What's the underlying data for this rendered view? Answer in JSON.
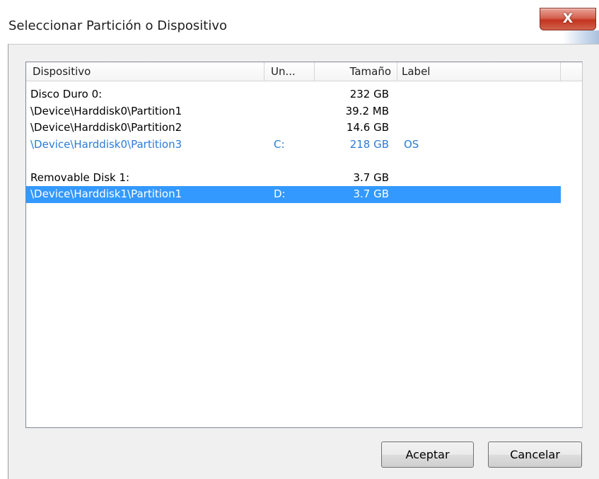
{
  "window": {
    "title": "Seleccionar Partición o Dispositivo",
    "close_label": "X"
  },
  "list": {
    "columns": [
      "Dispositivo",
      "Un...",
      "Tamaño",
      "Label"
    ],
    "rows": [
      {
        "device": "Disco Duro 0:",
        "unit": "",
        "size": "232 GB",
        "label": "",
        "style": "normal"
      },
      {
        "device": "\\Device\\Harddisk0\\Partition1",
        "unit": "",
        "size": "39.2 MB",
        "label": "",
        "style": "normal"
      },
      {
        "device": "\\Device\\Harddisk0\\Partition2",
        "unit": "",
        "size": "14.6 GB",
        "label": "",
        "style": "normal"
      },
      {
        "device": "\\Device\\Harddisk0\\Partition3",
        "unit": "C:",
        "size": "218 GB",
        "label": "OS",
        "style": "blue"
      },
      {
        "device": "",
        "unit": "",
        "size": "",
        "label": "",
        "style": "blank"
      },
      {
        "device": "Removable Disk 1:",
        "unit": "",
        "size": "3.7 GB",
        "label": "",
        "style": "normal"
      },
      {
        "device": "\\Device\\Harddisk1\\Partition1",
        "unit": "D:",
        "size": "3.7 GB",
        "label": "",
        "style": "selected"
      }
    ]
  },
  "buttons": {
    "ok_label": "Aceptar",
    "cancel_label": "Cancelar"
  },
  "colors": {
    "selection": "#3399ff",
    "mounted_text": "#2b7bd6",
    "close_button": "#c3341f"
  }
}
